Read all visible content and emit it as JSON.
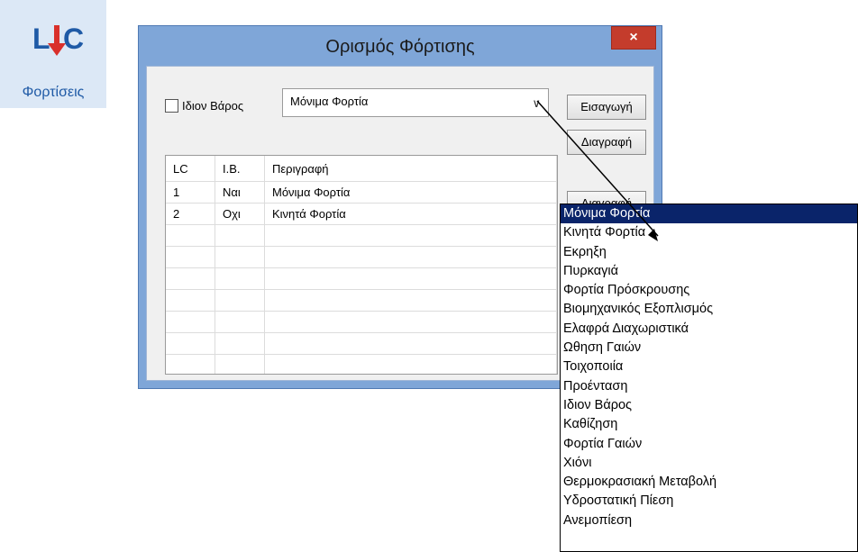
{
  "ribbon": {
    "icon_text": "LC",
    "label": "Φορτίσεις",
    "icon": "lc-down-arrow-icon"
  },
  "dialog": {
    "title": "Ορισμός Φόρτισης",
    "close_symbol": "×",
    "checkbox_label": "Ιδιον Βάρος",
    "combo_value": "Μόνιμα Φορτία",
    "buttons": {
      "insert": "Εισαγωγή",
      "delete": "Διαγραφή",
      "partial": "Διαγραφή"
    },
    "table": {
      "headers": [
        "LC",
        "I.B.",
        "Περιγραφή"
      ],
      "rows": [
        [
          "1",
          "Ναι",
          "Μόνιμα Φορτία"
        ],
        [
          "2",
          "Οχι",
          "Κινητά Φορτία"
        ]
      ]
    }
  },
  "dropdown": {
    "selected_index": 0,
    "items": [
      "Μόνιμα Φορτία",
      "Κινητά Φορτία",
      "Εκρηξη",
      "Πυρκαγιά",
      "Φορτία Πρόσκρουσης",
      "Βιομηχανικός Εξοπλισμός",
      "Ελαφρά Διαχωριστικά",
      "Ωθηση Γαιών",
      "Τοιχοποιία",
      "Προένταση",
      "Ιδιον Βάρος",
      "Καθίζηση",
      "Φορτία Γαιών",
      "Χιόνι",
      "Θερμοκρασιακή Μεταβολή",
      "Υδροστατική Πίεση",
      "Ανεμοπίεση"
    ]
  },
  "colors": {
    "selection": "#0a246a",
    "close": "#c43c2c",
    "dialog_frame": "#7fa6d8",
    "ribbon_bg": "#dce8f6",
    "icon_blue": "#1f5aa6",
    "icon_red": "#d9302b"
  }
}
